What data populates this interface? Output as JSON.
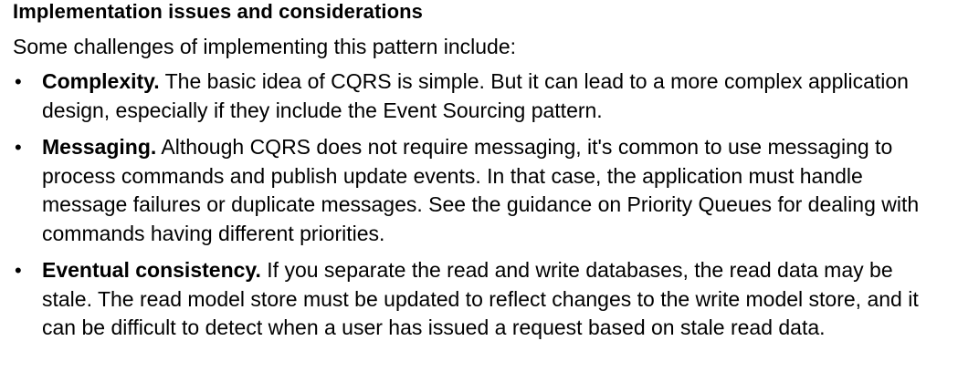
{
  "document": {
    "heading": "Implementation issues and considerations",
    "intro": "Some challenges of implementing this pattern include:",
    "bullet_glyph": "•",
    "items": [
      {
        "term": "Complexity.",
        "text": " The basic idea of CQRS is simple. But it can lead to a more complex application design, especially if they include the Event Sourcing pattern."
      },
      {
        "term": "Messaging.",
        "text": " Although CQRS does not require messaging, it's common to use messaging to process commands and publish update events. In that case, the application must handle message failures or duplicate messages. See the guidance on Priority Queues for dealing with commands having different priorities."
      },
      {
        "term": "Eventual consistency.",
        "text": " If you separate the read and write databases, the read data may be stale. The read model store must be updated to reflect changes to the write model store, and it can be difficult to detect when a user has issued a request based on stale read data."
      }
    ]
  }
}
